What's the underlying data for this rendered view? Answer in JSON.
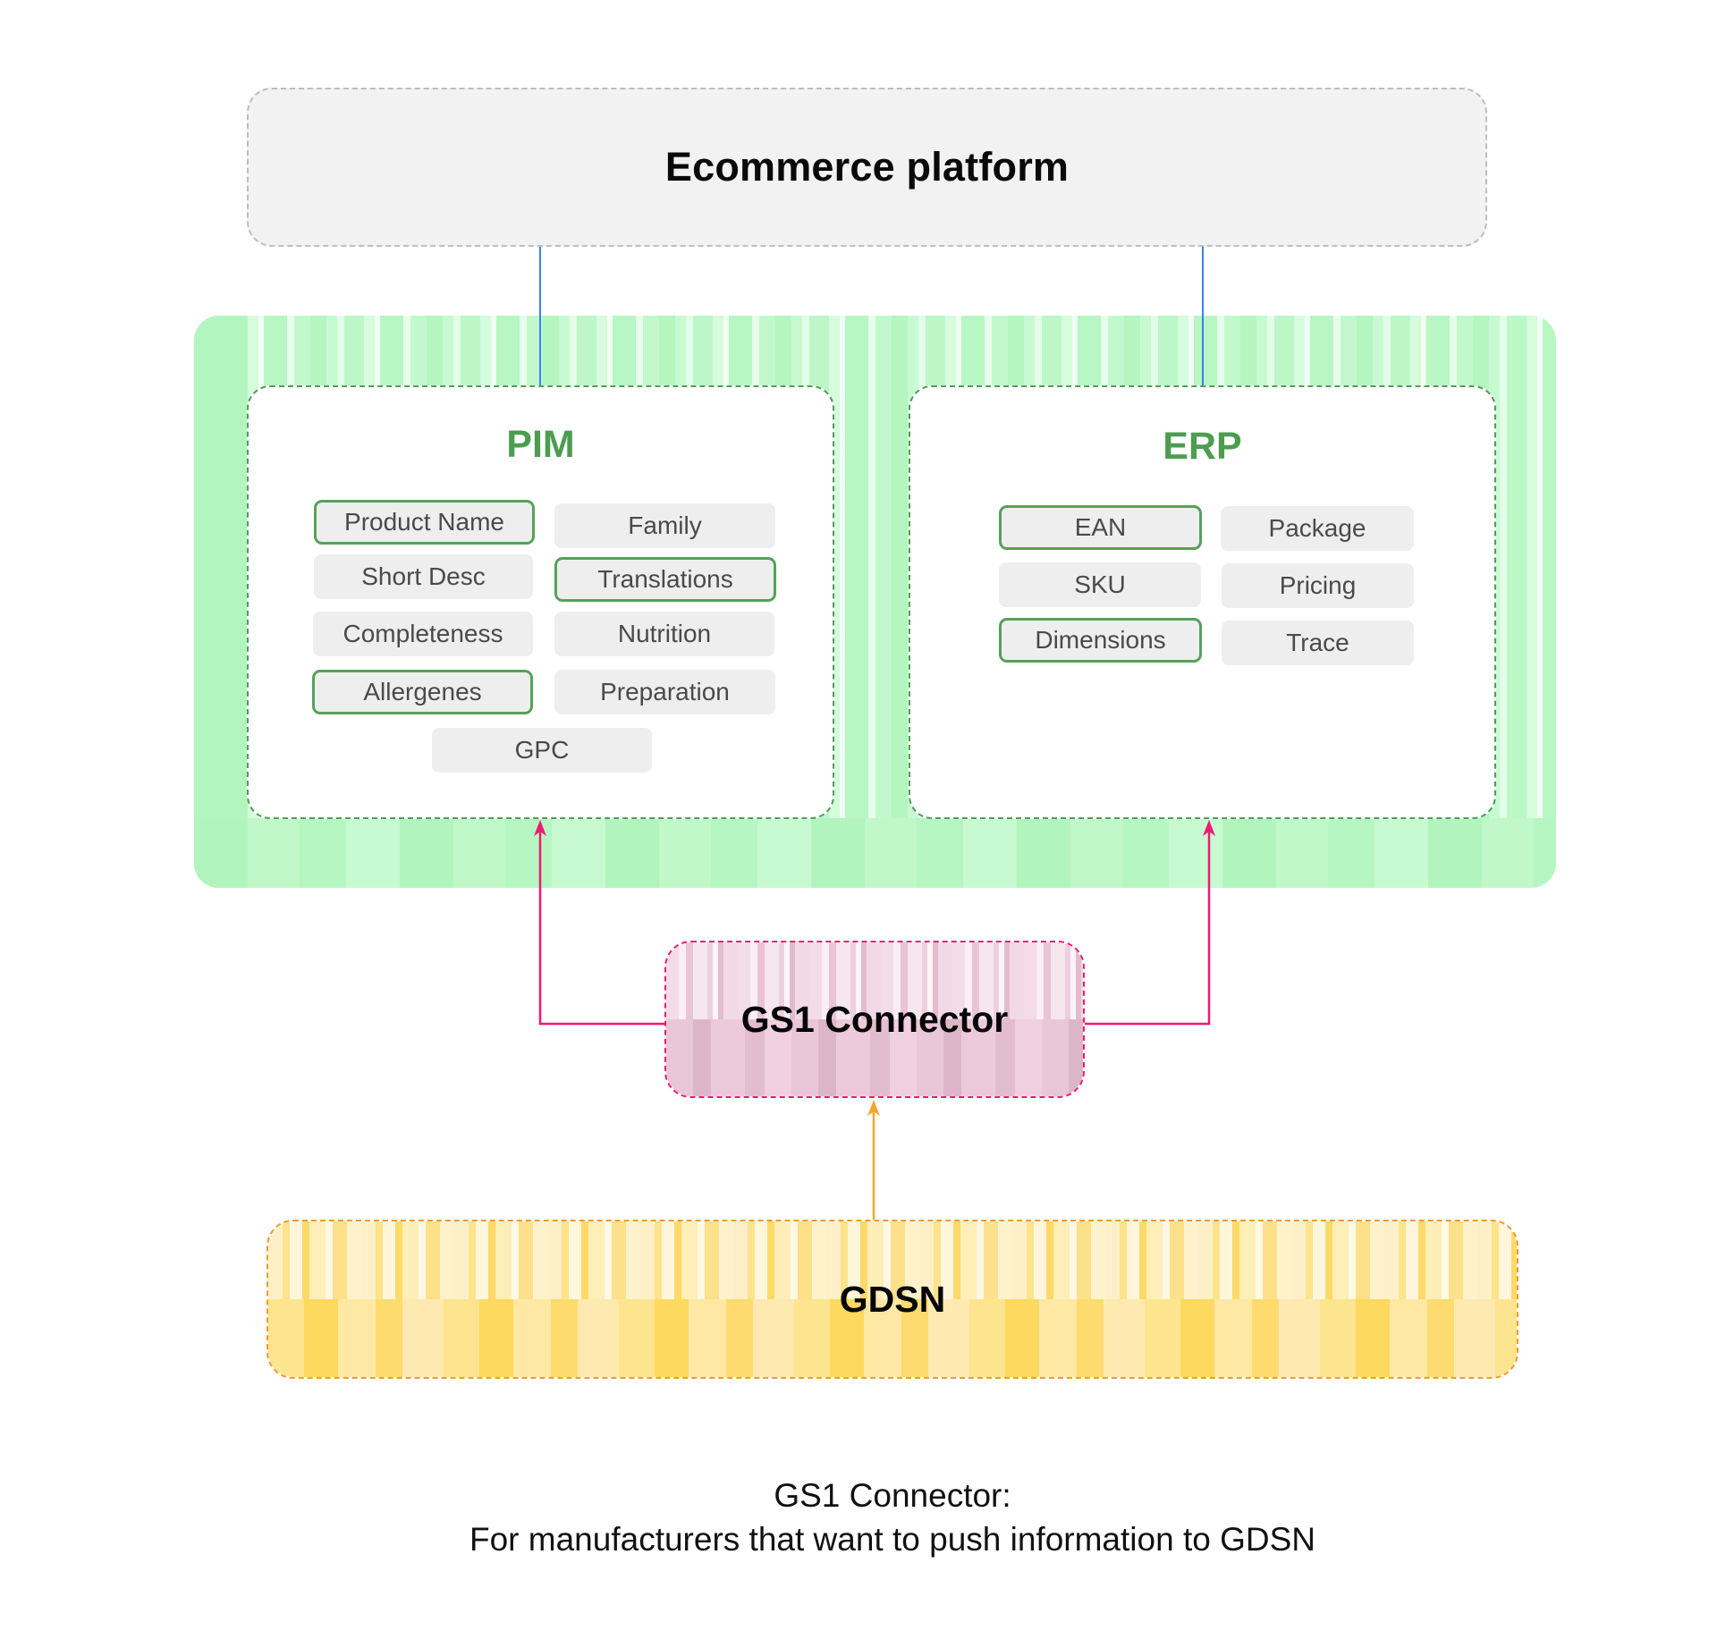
{
  "ecommerce": {
    "title": "Ecommerce platform"
  },
  "pim": {
    "title": "PIM",
    "fields": [
      {
        "label": "Product Name",
        "highlighted": true
      },
      {
        "label": "Family",
        "highlighted": false
      },
      {
        "label": "Short Desc",
        "highlighted": false
      },
      {
        "label": "Translations",
        "highlighted": true
      },
      {
        "label": "Completeness",
        "highlighted": false
      },
      {
        "label": "Nutrition",
        "highlighted": false
      },
      {
        "label": "Allergenes",
        "highlighted": true
      },
      {
        "label": "Preparation",
        "highlighted": false
      },
      {
        "label": "GPC",
        "highlighted": false
      }
    ]
  },
  "erp": {
    "title": "ERP",
    "fields": [
      {
        "label": "EAN",
        "highlighted": true
      },
      {
        "label": "Package",
        "highlighted": false
      },
      {
        "label": "SKU",
        "highlighted": false
      },
      {
        "label": "Pricing",
        "highlighted": false
      },
      {
        "label": "Dimensions",
        "highlighted": true
      },
      {
        "label": "Trace",
        "highlighted": false
      }
    ]
  },
  "connector": {
    "title": "GS1 Connector"
  },
  "gdsn": {
    "title": "GDSN"
  },
  "caption": {
    "line1": "GS1 Connector:",
    "line2": "For manufacturers that want to push information to GDSN"
  },
  "colors": {
    "ecommerce_link": "#3b82f0",
    "connector_link": "#ef1a73",
    "gdsn_link": "#f5a52c",
    "system_accent": "#4c9d50"
  },
  "edges": [
    {
      "from": "PIM",
      "to": "Ecommerce platform",
      "style": "line",
      "color": "ecommerce_link"
    },
    {
      "from": "ERP",
      "to": "Ecommerce platform",
      "style": "line",
      "color": "ecommerce_link"
    },
    {
      "from": "GS1 Connector",
      "to": "PIM",
      "style": "arrow",
      "color": "connector_link"
    },
    {
      "from": "GS1 Connector",
      "to": "ERP",
      "style": "arrow",
      "color": "connector_link"
    },
    {
      "from": "GDSN",
      "to": "GS1 Connector",
      "style": "arrow",
      "color": "gdsn_link"
    }
  ]
}
